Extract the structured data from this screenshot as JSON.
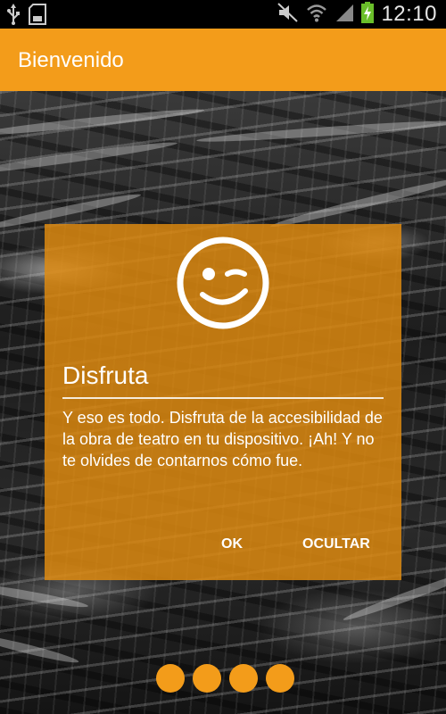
{
  "status_bar": {
    "time": "12:10",
    "icons": [
      "usb-icon",
      "sd-card-icon",
      "mute-icon",
      "wifi-icon",
      "signal-icon",
      "battery-charging-icon"
    ]
  },
  "app_bar": {
    "title": "Bienvenido"
  },
  "dialog": {
    "icon": "wink-smiley-icon",
    "title": "Disfruta",
    "body": "Y eso es todo. Disfruta de la accesibilidad de la obra de teatro en tu dispositivo. ¡Ah! Y no te olvides de contarnos cómo fue.",
    "ok_label": "OK",
    "hide_label": "OCULTAR"
  },
  "pager": {
    "page_count": 4
  },
  "colors": {
    "accent": "#f39c1a",
    "dialog_bg": "#df8a10",
    "status_bar": "#000000"
  }
}
